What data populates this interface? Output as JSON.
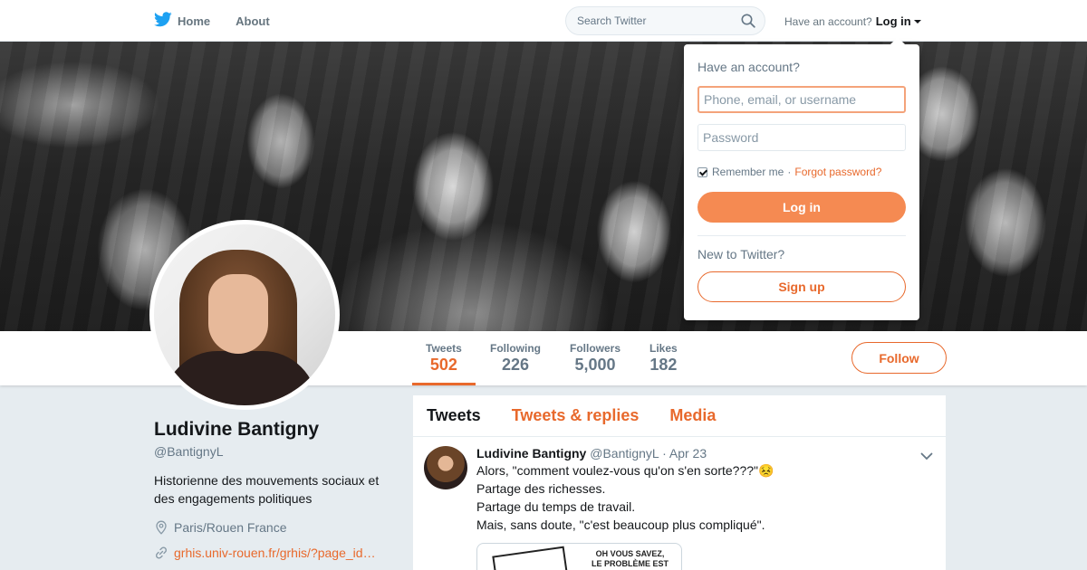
{
  "nav": {
    "home_label": "Home",
    "about_label": "About",
    "search_placeholder": "Search Twitter",
    "have_account": "Have an account?",
    "login_label": "Log in"
  },
  "login_dropdown": {
    "title": "Have an account?",
    "username_placeholder": "Phone, email, or username",
    "password_placeholder": "Password",
    "remember_label": "Remember me",
    "separator": "·",
    "forgot_label": "Forgot password?",
    "login_button": "Log in",
    "new_label": "New to Twitter?",
    "signup_button": "Sign up",
    "remember_checked": true
  },
  "profile_nav": {
    "stats": [
      {
        "label": "Tweets",
        "value": "502",
        "active": true
      },
      {
        "label": "Following",
        "value": "226"
      },
      {
        "label": "Followers",
        "value": "5,000"
      },
      {
        "label": "Likes",
        "value": "182"
      }
    ],
    "follow_button": "Follow"
  },
  "profile": {
    "name": "Ludivine Bantigny",
    "handle": "@BantignyL",
    "bio": "Historienne des mouvements sociaux et des engagements politiques",
    "location": "Paris/Rouen France",
    "url": "grhis.univ-rouen.fr/grhis/?page_id…"
  },
  "timeline": {
    "tabs": [
      "Tweets",
      "Tweets & replies",
      "Media"
    ],
    "active_tab": "Tweets",
    "tweet": {
      "name": "Ludivine Bantigny",
      "handle": "@BantignyL",
      "date": "· Apr 23",
      "lines": [
        "Alors, \"comment voulez-vous qu'on s'en sorte???\"😣",
        "Partage des richesses.",
        "Partage du temps de travail.",
        "Mais, sans doute, \"c'est beaucoup plus compliqué\"."
      ],
      "media_caption_1": "OH VOUS SAVEZ,",
      "media_caption_2": "LE PROBLÈME EST"
    }
  },
  "colors": {
    "accent": "#e8692c",
    "login_button": "#f58a52",
    "twitter_blue": "#1da1f2"
  }
}
